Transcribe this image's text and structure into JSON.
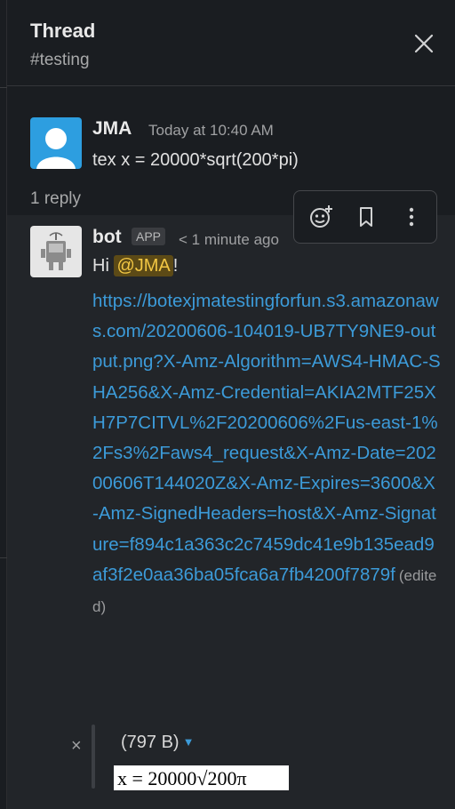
{
  "header": {
    "title": "Thread",
    "channel": "#testing",
    "close_icon": "close-icon"
  },
  "parent_message": {
    "author": "JMA",
    "timestamp": "Today at 10:40 AM",
    "text": "tex x = 20000*sqrt(200*pi)",
    "avatar_icon": "user-avatar-icon"
  },
  "reply_count": "1 reply",
  "reply": {
    "author": "bot",
    "badge": "APP",
    "timestamp": "< 1 minute ago",
    "greeting": "Hi ",
    "mention": "@JMA",
    "greeting_end": "!",
    "link_text": "https://botexjmatestingforfun.s3.amazonaws.com/20200606-104019-UB7TY9NE9-output.png?X-Amz-Algorithm=AWS4-HMAC-SHA256&X-Amz-Credential=AKIA2MTF25XH7P7CITVL%2F20200606%2Fus-east-1%2Fs3%2Faws4_request&X-Amz-Date=20200606T144020Z&X-Amz-Expires=3600&X-Amz-SignedHeaders=host&X-Amz-Signature=f894c1a363c2c7459dc41e9b135ead9af3f2e0aa36ba05fca6a7fb4200f7879f",
    "edited": "(edited)",
    "avatar_icon": "bot-avatar-icon"
  },
  "toolbar": {
    "react_icon": "add-reaction-icon",
    "bookmark_icon": "bookmark-icon",
    "more_icon": "more-actions-icon"
  },
  "attachment": {
    "size": "(797 B)",
    "dismiss": "×",
    "caret_icon": "caret-down-icon",
    "rendered_formula": "x = 20000√200π"
  },
  "colors": {
    "background": "#1a1d21",
    "reply_bg": "#222529",
    "link": "#3c9bd9",
    "mention_bg": "#5c4a16",
    "mention_text": "#f2c744"
  }
}
